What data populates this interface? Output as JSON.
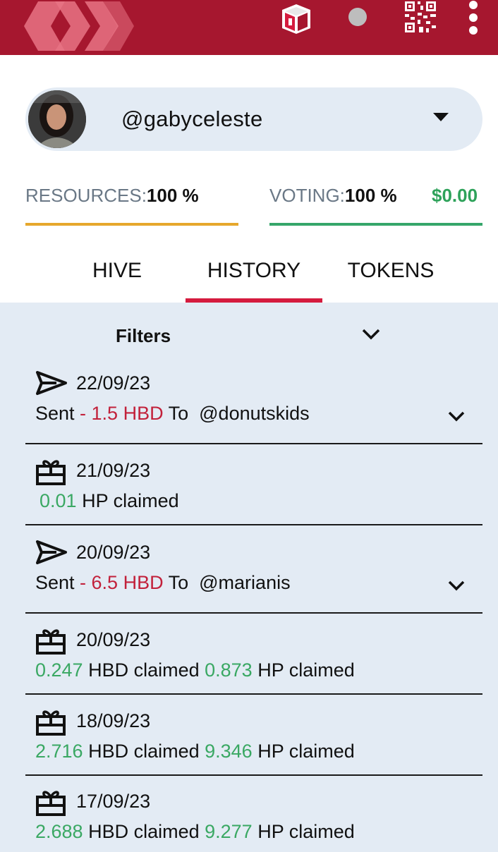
{
  "header": {
    "icons": [
      "hive-logo-icon",
      "keychain-icon",
      "status-dot-icon",
      "qr-code-icon",
      "more-vert-icon"
    ]
  },
  "account": {
    "username": "@gabyceleste"
  },
  "resources": {
    "resources_label": "RESOURCES:",
    "resources_value": "100 %",
    "voting_label": "VOTING:",
    "voting_value": "100 %",
    "vote_value_usd": "$0.00",
    "resources_level": 1.0,
    "voting_level": 1.0
  },
  "tabs": [
    {
      "label": "HIVE",
      "active": false
    },
    {
      "label": "HISTORY",
      "active": true
    },
    {
      "label": "TOKENS",
      "active": false
    }
  ],
  "filters": {
    "label": "Filters"
  },
  "history": [
    {
      "type": "transfer",
      "icon": "send-icon",
      "date": "22/09/23",
      "prefix": "Sent ",
      "amount": "- 1.5 HBD",
      "middle": " To  ",
      "target": "@donutskids"
    },
    {
      "type": "claim",
      "icon": "gift-icon",
      "date": "21/09/23",
      "hp_amount": "0.01",
      "hp_text": " HP claimed"
    },
    {
      "type": "transfer",
      "icon": "send-icon",
      "date": "20/09/23",
      "prefix": "Sent ",
      "amount": "- 6.5 HBD",
      "middle": " To  ",
      "target": "@marianis"
    },
    {
      "type": "claim2",
      "icon": "gift-icon",
      "date": "20/09/23",
      "hbd_amount": "0.247",
      "hbd_text": " HBD claimed ",
      "hp_amount": "0.873",
      "hp_text": " HP claimed"
    },
    {
      "type": "claim2",
      "icon": "gift-icon",
      "date": "18/09/23",
      "hbd_amount": "2.716",
      "hbd_text": " HBD claimed ",
      "hp_amount": "9.346",
      "hp_text": " HP claimed"
    },
    {
      "type": "claim2",
      "icon": "gift-icon",
      "date": "17/09/23",
      "hbd_amount": "2.688",
      "hbd_text": " HBD claimed ",
      "hp_amount": "9.277",
      "hp_text": " HP claimed"
    }
  ],
  "colors": {
    "header_bg": "#a6172f",
    "tab_indicator": "#d51b3e",
    "resources_bar": "#e6a72c",
    "voting_bar": "#36a66a",
    "negative": "#c2213b",
    "positive": "#3aa863",
    "panel_bg": "#e3ebf4"
  }
}
